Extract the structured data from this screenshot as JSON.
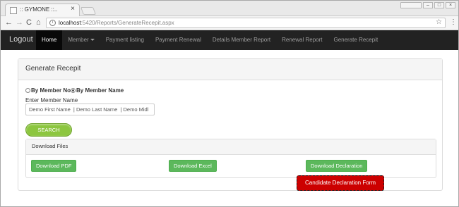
{
  "browser": {
    "tab_title": ":: GYMONE ::..",
    "tab_close": "×",
    "url_host": "localhost",
    "url_path": ":5420/Reports/GenerateRecepit.aspx",
    "nav_back": "←",
    "nav_forward": "→",
    "nav_reload": "C",
    "nav_home": "⌂",
    "star": "☆",
    "menu": "⋮",
    "window_minimize": "–",
    "window_maximize": "□",
    "window_close": "×"
  },
  "navbar": {
    "brand": "Logout",
    "items": [
      {
        "label": "Home",
        "active": true
      },
      {
        "label": "Member",
        "dropdown": true
      },
      {
        "label": "Payment listing"
      },
      {
        "label": "Payment Renewal"
      },
      {
        "label": "Details Member Report"
      },
      {
        "label": "Renewal Report"
      },
      {
        "label": "Generate Recepit"
      }
    ]
  },
  "panel": {
    "heading": "Generate Recepit",
    "radio_member_no": "By Member No",
    "radio_member_name": "By Member Name",
    "member_name_label": "Enter Member Name",
    "member_name_value": "Demo First Name  | Demo Last Name  | Demo Midl",
    "search_button": "SEARCH",
    "download": {
      "heading": "Download Files",
      "pdf": "Download PDF",
      "excel": "Download Excel",
      "declaration": "Download Declaration"
    }
  },
  "candidate_declaration": "Candidate Declaration Form",
  "colors": {
    "navbar_bg": "#222222",
    "search_green": "#8cc63f",
    "download_green": "#5cb85c",
    "candidate_red": "#cc0000"
  }
}
